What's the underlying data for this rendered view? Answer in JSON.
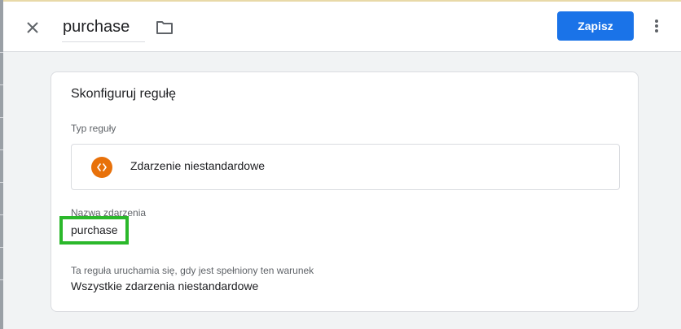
{
  "header": {
    "trigger_name": "purchase",
    "save_label": "Zapisz"
  },
  "card": {
    "title": "Skonfiguruj regułę",
    "trigger_type_label": "Typ reguły",
    "trigger_type_value": "Zdarzenie niestandardowe",
    "event_name_label": "Nazwa zdarzenia",
    "event_name_value": "purchase",
    "fires_on_label": "Ta reguła uruchamia się, gdy jest spełniony ten warunek",
    "fires_on_value": "Wszystkie zdarzenia niestandardowe"
  },
  "icons": {
    "close": "close-icon",
    "folder": "folder-icon",
    "more": "more-vert-icon",
    "custom_event": "code-brackets-icon"
  },
  "colors": {
    "primary": "#1a73e8",
    "custom_event_icon_bg": "#e8710a",
    "highlight": "#2bb82b"
  }
}
